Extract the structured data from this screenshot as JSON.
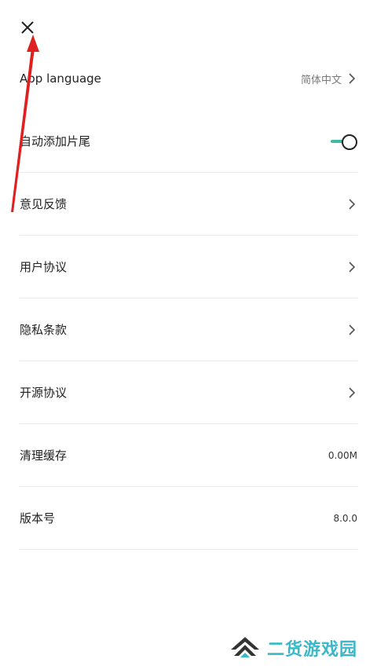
{
  "header": {
    "close_icon": "close-icon"
  },
  "settings": {
    "items": [
      {
        "label": "App language",
        "value": "简体中文",
        "type": "link"
      },
      {
        "label": "自动添加片尾",
        "type": "toggle",
        "on": true
      },
      {
        "label": "意见反馈",
        "type": "link"
      },
      {
        "label": "用户协议",
        "type": "link"
      },
      {
        "label": "隐私条款",
        "type": "link"
      },
      {
        "label": "开源协议",
        "type": "link"
      },
      {
        "label": "清理缓存",
        "value": "0.00M",
        "type": "value"
      },
      {
        "label": "版本号",
        "value": "8.0.0",
        "type": "value"
      }
    ]
  },
  "colors": {
    "accent": "#42b8a8",
    "annotation": "#e02020",
    "watermark": "#3ab8c9"
  },
  "watermark": {
    "text": "二货游戏园"
  }
}
